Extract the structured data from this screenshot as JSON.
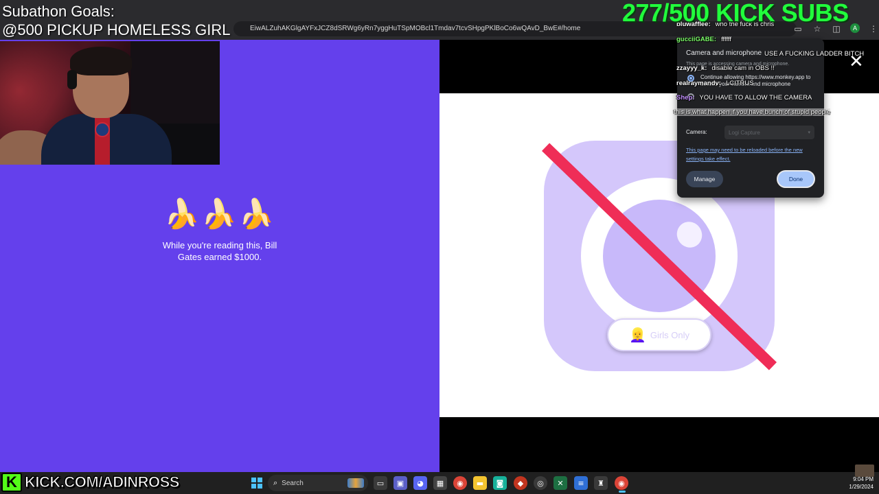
{
  "browser": {
    "url": "EiwALZuhAKGlgAYFxJCZ8dSRWg6yRn7yggHuTSpMOBcl1Tmdav7tcvSHpgPKlBoCo6wQAvD_BwE#/home"
  },
  "overlay": {
    "goal_title": "Subathon Goals:",
    "goal_text": "@500 PICKUP HOMELESS GIRL",
    "subs_count": "277/500 KICK SUBS",
    "brand_letter": "K",
    "brand_url": "KICK.COM/ADINROSS"
  },
  "left_page": {
    "emojis": "🍌🍌🍌",
    "tip_text": "While you're reading this, Bill Gates earned $1000."
  },
  "right_page": {
    "girls_button_emoji": "👱‍♀️",
    "girls_button_label": "Girls Only",
    "close_glyph": "✕"
  },
  "permission_popup": {
    "title": "Camera and microphone",
    "description": "This page is accessing camera and microphone.",
    "option_1": "Continue allowing https://www.monkey.app to access your camera and microphone",
    "camera_label": "Camera:",
    "camera_value": "Logi Capture",
    "reload_note": "This page may need to be reloaded before the new settings take effect.",
    "manage_label": "Manage",
    "done_label": "Done"
  },
  "chat": [
    {
      "user": "",
      "message": "",
      "color": "#ffffff"
    },
    {
      "user": "bluwafflee:",
      "message": "who the fuck is chris",
      "color": "#ffffff"
    },
    {
      "user": "gucciiGABE:",
      "message": "ffffff",
      "color": "#7dff6a"
    },
    {
      "user": "",
      "message": "USE A FUCKING LADDER BITCH",
      "color": "#b07cff"
    },
    {
      "user": "zzayyy_k:",
      "message": "disable cam in OBS !!",
      "color": "#ffffff"
    },
    {
      "user": "realraymandv:",
      "message": "LCITRUS",
      "color": "#ffffff"
    },
    {
      "user": "Shep:",
      "message": "YOU HAVE TO ALLOW THE CAMERA",
      "color": "#c490ff"
    },
    {
      "user": "",
      "message": "this is what happen if you have bunch of stupid people",
      "color": "#ffffff"
    }
  ],
  "taskbar": {
    "search_label": "Search",
    "clock_time": "9:04 PM",
    "clock_date": "1/29/2024"
  },
  "colors": {
    "left_page_bg": "#6440ec",
    "subs_green": "#21ff3c",
    "kick_green": "#53fc18",
    "slash_red": "#ef2d57"
  }
}
